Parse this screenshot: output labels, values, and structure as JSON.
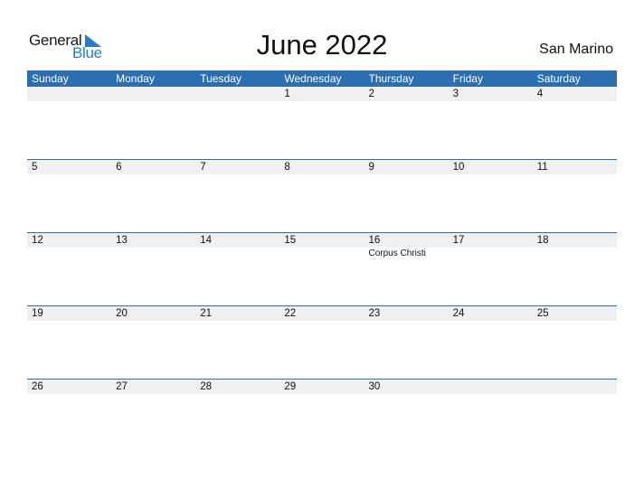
{
  "logo": {
    "word1": "General",
    "word2": "Blue",
    "brand_color": "#2a7bc4"
  },
  "header": {
    "title": "June 2022",
    "country": "San Marino"
  },
  "colors": {
    "header_bg": "#2b6fb0",
    "band_bg": "#f0f0f0"
  },
  "days_of_week": [
    "Sunday",
    "Monday",
    "Tuesday",
    "Wednesday",
    "Thursday",
    "Friday",
    "Saturday"
  ],
  "weeks": [
    [
      {
        "day": ""
      },
      {
        "day": ""
      },
      {
        "day": ""
      },
      {
        "day": "1"
      },
      {
        "day": "2"
      },
      {
        "day": "3"
      },
      {
        "day": "4"
      }
    ],
    [
      {
        "day": "5"
      },
      {
        "day": "6"
      },
      {
        "day": "7"
      },
      {
        "day": "8"
      },
      {
        "day": "9"
      },
      {
        "day": "10"
      },
      {
        "day": "11"
      }
    ],
    [
      {
        "day": "12"
      },
      {
        "day": "13"
      },
      {
        "day": "14"
      },
      {
        "day": "15"
      },
      {
        "day": "16",
        "event": "Corpus Christi"
      },
      {
        "day": "17"
      },
      {
        "day": "18"
      }
    ],
    [
      {
        "day": "19"
      },
      {
        "day": "20"
      },
      {
        "day": "21"
      },
      {
        "day": "22"
      },
      {
        "day": "23"
      },
      {
        "day": "24"
      },
      {
        "day": "25"
      }
    ],
    [
      {
        "day": "26"
      },
      {
        "day": "27"
      },
      {
        "day": "28"
      },
      {
        "day": "29"
      },
      {
        "day": "30"
      },
      {
        "day": ""
      },
      {
        "day": ""
      }
    ]
  ]
}
